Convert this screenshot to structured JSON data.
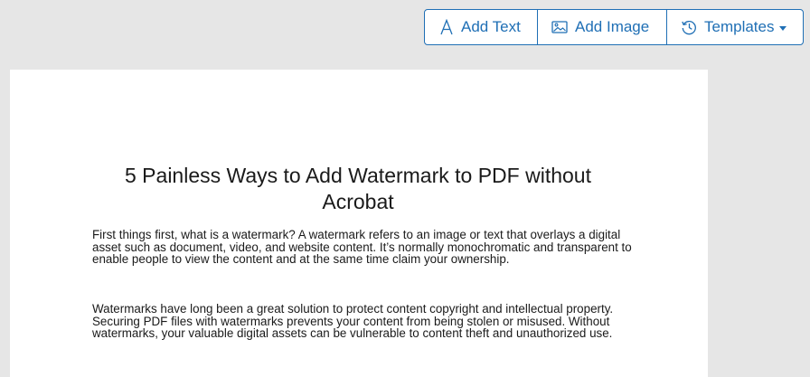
{
  "toolbar": {
    "add_text_label": "Add Text",
    "add_image_label": "Add Image",
    "templates_label": "Templates",
    "icons": {
      "add_text": "letter-a-icon",
      "add_image": "image-icon",
      "templates": "history-icon",
      "templates_menu": "caret-down-icon"
    },
    "accent_color": "#1f6fb5"
  },
  "document": {
    "title": "5 Painless Ways to Add Watermark to PDF without Acrobat",
    "paragraphs": [
      "First things first, what is a watermark? A watermark refers to an image or text that overlays a digital asset such as document, video, and website content. It’s normally monochromatic and transparent to enable people to view the content and at the same time claim your ownership.",
      "Watermarks have long been a great solution to protect content copyright and intellectual property. Securing PDF files with watermarks prevents your content from being stolen or misused. Without watermarks, your valuable digital assets can be vulnerable to content theft and unauthorized use."
    ]
  },
  "colors": {
    "background": "#e6e6e6",
    "page": "#ffffff",
    "text": "#1a1a1a"
  }
}
